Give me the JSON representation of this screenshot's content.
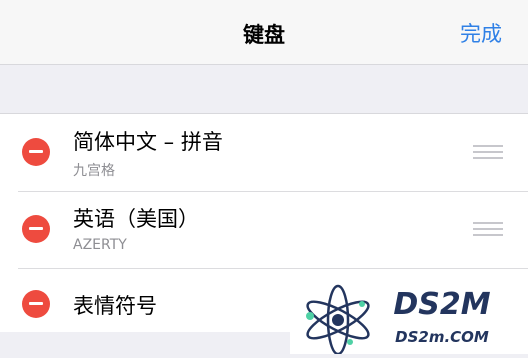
{
  "nav": {
    "title": "键盘",
    "done_label": "完成"
  },
  "keyboards": [
    {
      "title": "简体中文 – 拼音",
      "subtitle": "九宫格",
      "reorderable": true
    },
    {
      "title": "英语（美国）",
      "subtitle": "AZERTY",
      "reorderable": true
    },
    {
      "title": "表情符号",
      "subtitle": "",
      "reorderable": false
    }
  ],
  "watermark": {
    "brand": "DS2M",
    "domain": "DS2m.COM"
  },
  "colors": {
    "accent": "#2f80e6",
    "delete": "#ee4b3f",
    "background": "#efeff4"
  }
}
